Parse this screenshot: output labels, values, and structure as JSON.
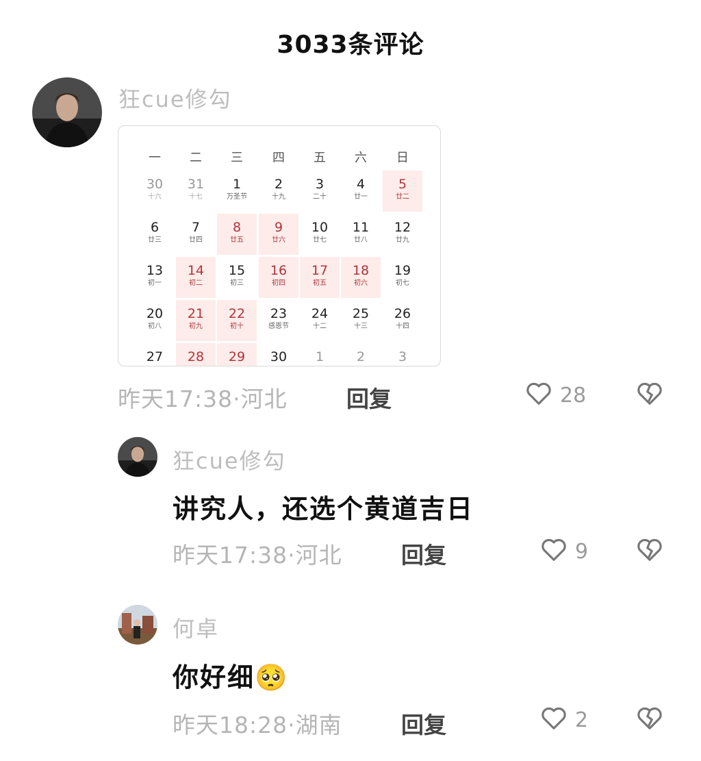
{
  "header": {
    "title": "3033条评论"
  },
  "comment1": {
    "username": "狂cue修勾",
    "meta": "昨天17:38·河北",
    "reply": "回复",
    "likes": "28",
    "calendar": {
      "weekdays": [
        "一",
        "二",
        "三",
        "四",
        "五",
        "六",
        "日"
      ],
      "weeks": [
        [
          {
            "d": "30",
            "s": "十六",
            "dim": true
          },
          {
            "d": "31",
            "s": "十七",
            "dim": true
          },
          {
            "d": "1",
            "s": "万圣节"
          },
          {
            "d": "2",
            "s": "十九"
          },
          {
            "d": "3",
            "s": "二十"
          },
          {
            "d": "4",
            "s": "廿一"
          },
          {
            "d": "5",
            "s": "廿二",
            "hl": true
          }
        ],
        [
          {
            "d": "6",
            "s": "廿三"
          },
          {
            "d": "7",
            "s": "廿四"
          },
          {
            "d": "8",
            "s": "廿五",
            "hl": true
          },
          {
            "d": "9",
            "s": "廿六",
            "hl": true
          },
          {
            "d": "10",
            "s": "廿七"
          },
          {
            "d": "11",
            "s": "廿八"
          },
          {
            "d": "12",
            "s": "廿九"
          }
        ],
        [
          {
            "d": "13",
            "s": "初一"
          },
          {
            "d": "14",
            "s": "初二",
            "hl": true
          },
          {
            "d": "15",
            "s": "初三"
          },
          {
            "d": "16",
            "s": "初四",
            "hl": true
          },
          {
            "d": "17",
            "s": "初五",
            "hl": true
          },
          {
            "d": "18",
            "s": "初六",
            "hl": true
          },
          {
            "d": "19",
            "s": "初七"
          }
        ],
        [
          {
            "d": "20",
            "s": "初八"
          },
          {
            "d": "21",
            "s": "初九",
            "hl": true
          },
          {
            "d": "22",
            "s": "初十",
            "hl": true
          },
          {
            "d": "23",
            "s": "感恩节"
          },
          {
            "d": "24",
            "s": "十二"
          },
          {
            "d": "25",
            "s": "十三"
          },
          {
            "d": "26",
            "s": "十四"
          }
        ],
        [
          {
            "d": "27",
            "s": ""
          },
          {
            "d": "28",
            "s": "",
            "hl": true
          },
          {
            "d": "29",
            "s": "",
            "hl": true
          },
          {
            "d": "30",
            "s": ""
          },
          {
            "d": "1",
            "s": "",
            "dim": true
          },
          {
            "d": "2",
            "s": "",
            "dim": true
          },
          {
            "d": "3",
            "s": "",
            "dim": true
          }
        ]
      ]
    }
  },
  "reply1": {
    "username": "狂cue修勾",
    "text": "讲究人，还选个黄道吉日",
    "meta": "昨天17:38·河北",
    "reply": "回复",
    "likes": "9"
  },
  "reply2": {
    "username": "何卓",
    "text": "你好细",
    "emoji": "🥺",
    "meta": "昨天18:28·湖南",
    "reply": "回复",
    "likes": "2"
  },
  "icons": {
    "like": "heart-outline-icon",
    "dislike": "broken-heart-icon"
  },
  "colors": {
    "highlight_bg": "#fdecea",
    "highlight_text": "#b0343a",
    "muted": "#b5b5b5"
  }
}
